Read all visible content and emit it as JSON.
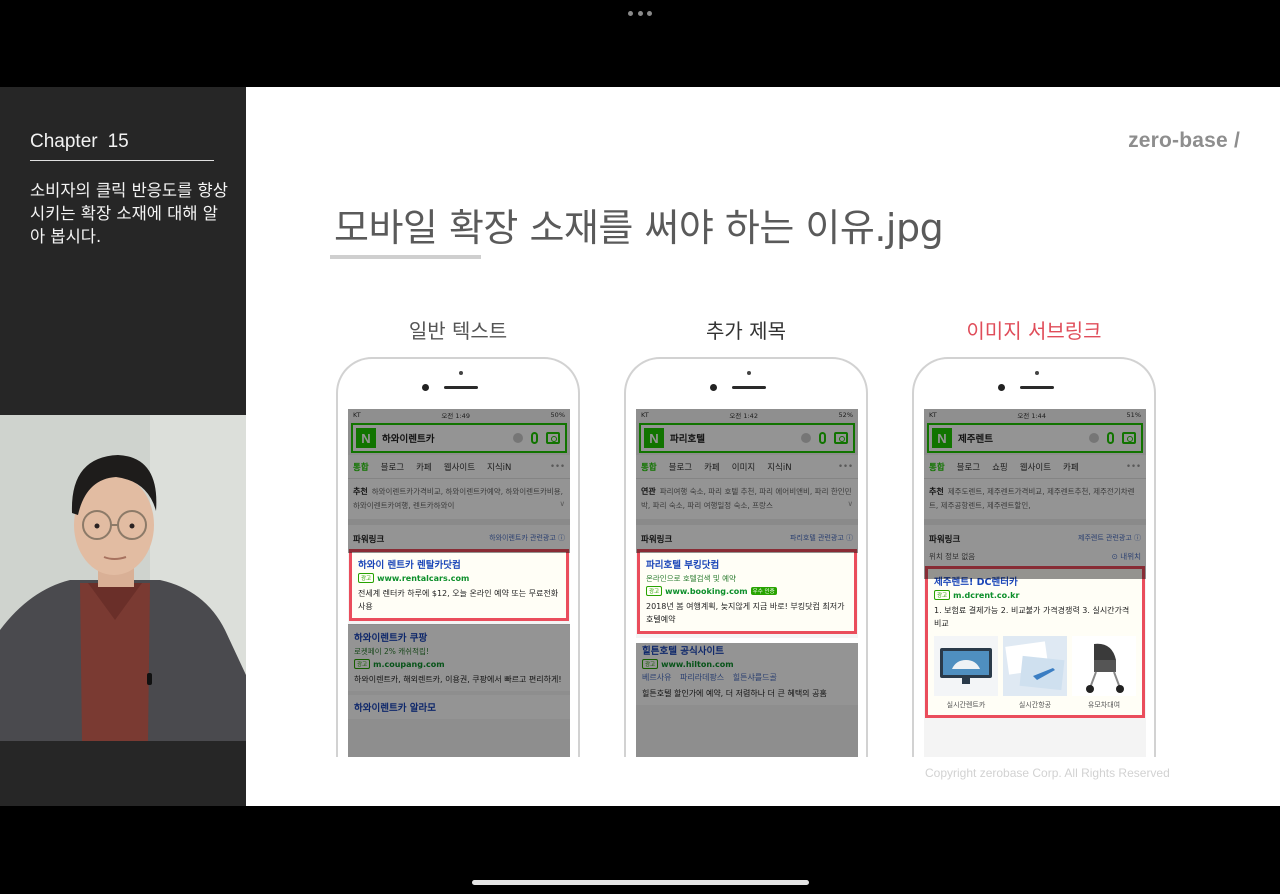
{
  "sidebar": {
    "chapter_label": "Chapter",
    "chapter_number": "15",
    "description": "소비자의 클릭 반응도를 향상 시키는 확장 소재에 대해 알아 봅시다."
  },
  "slide": {
    "logo": "zero-base /",
    "title": "모바일 확장 소재를 써야 하는 이유.jpg",
    "copyright": "Copyright zerobase Corp. All Rights Reserved",
    "columns": [
      "일반 텍스트",
      "추가 제목",
      "이미지 서브링크"
    ]
  },
  "phones": [
    {
      "status": {
        "carrier": "KT",
        "time": "오전 1:49",
        "battery": "50%"
      },
      "query": "하와이렌트카",
      "tabs": [
        "통합",
        "블로그",
        "카페",
        "웹사이트",
        "지식iN"
      ],
      "related_label": "추천",
      "related_text": "하와이렌트카가격비교, 하와이렌트카예약, 하와이렌트카비용, 하와이렌트카여행, 렌트카하와이",
      "powerlink": "파워링크",
      "ad_info": "하와이렌트카 관련광고",
      "ads": [
        {
          "title": "하와이 렌트카 렌탈카닷컴",
          "url": "www.rentalcars.com",
          "desc": "전세계 렌터카 하루에 $12, 오늘 온라인 예약 또는 무료전화 사용"
        },
        {
          "title": "하와이렌트카 쿠팡",
          "sub": "로켓페이 2% 캐쉬적립!",
          "url": "m.coupang.com",
          "desc": "하와이렌트카, 해외렌트카, 이용권, 쿠팡에서 빠르고 편리하게!"
        },
        {
          "title": "하와이렌트카 알라모"
        }
      ]
    },
    {
      "status": {
        "carrier": "KT",
        "time": "오전 1:42",
        "battery": "52%"
      },
      "query": "파리호텔",
      "tabs": [
        "통합",
        "블로그",
        "카페",
        "이미지",
        "지식iN"
      ],
      "related_label": "연관",
      "related_text": "파리여행 숙소, 파리 호텔 추천, 파리 에어비앤비, 파리 한인민박, 파리 숙소, 파리 여행일정 숙소, 프랑스",
      "powerlink": "파워링크",
      "ad_info": "파리호텔 관련광고",
      "ads": [
        {
          "title": "파리호텔 부킹닷컴",
          "sub": "온라인으로 호텔검색 및 예약",
          "url": "www.booking.com",
          "cert": "우수 인증",
          "desc": "2018년 봄 여행계획, 늦지않게 지금 바로! 부킹닷컴 최저가호텔예약"
        },
        {
          "title": "힐튼호텔 공식사이트",
          "url": "www.hilton.com",
          "links": [
            "베르사유",
            "파리라데팡스",
            "힐튼샤를드골"
          ],
          "desc": "힐튼호텔 할인가에 예약, 더 저렴하나 더 큰 혜택의 공홈"
        }
      ]
    },
    {
      "status": {
        "carrier": "KT",
        "time": "오전 1:44",
        "battery": "51%"
      },
      "query": "제주렌트",
      "tabs": [
        "통합",
        "블로그",
        "쇼핑",
        "웹사이트",
        "카페"
      ],
      "related_label": "추천",
      "related_text": "제주도렌트, 제주렌트가격비교, 제주렌트추천, 제주전기차렌트, 제주공항렌트, 제주렌트할인,",
      "powerlink": "파워링크",
      "ad_info": "제주렌트 관련광고",
      "location_text": "위치 정보 없음",
      "location_right": "내위치",
      "ads": [
        {
          "title": "제주렌트! DC렌터카",
          "url": "m.dcrent.co.kr",
          "desc": "1. 보험료 결제가능 2. 비교불가 가격경쟁력 3. 실시간가격비교",
          "images": [
            "실시간렌트카",
            "실시간항공",
            "유모차대여"
          ]
        }
      ]
    }
  ],
  "colors": {
    "accent_red": "#ea4d5c",
    "naver_green": "#1ec800",
    "link_blue": "#1b46b8",
    "url_green": "#0d8f2b"
  }
}
